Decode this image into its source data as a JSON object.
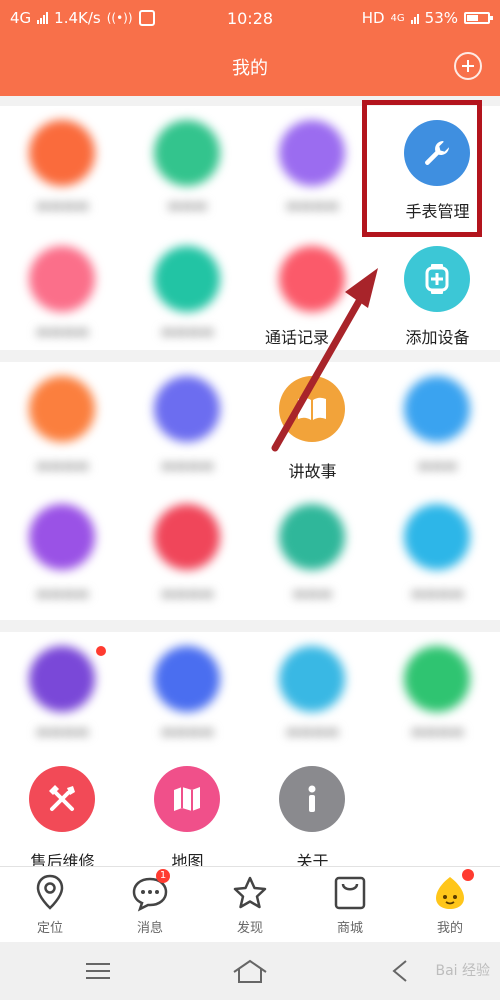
{
  "status": {
    "network": "4G",
    "speed": "1.4K/s",
    "time": "10:28",
    "hd": "HD",
    "net2": "4G",
    "battery": "53%",
    "battery_level": 0.53
  },
  "header": {
    "title": "我的"
  },
  "grid": {
    "watch_manage": "手表管理",
    "call_log": "通话记录",
    "add_device": "添加设备",
    "story": "讲故事",
    "repair": "售后维修",
    "map": "地图",
    "about": "关于"
  },
  "tabs": [
    {
      "label": "定位"
    },
    {
      "label": "消息",
      "badge": "1"
    },
    {
      "label": "发现"
    },
    {
      "label": "商城"
    },
    {
      "label": "我的"
    }
  ],
  "watermark": "Bai 经验",
  "colors": {
    "accent": "#f8704a",
    "highlight": "#b3141d"
  }
}
